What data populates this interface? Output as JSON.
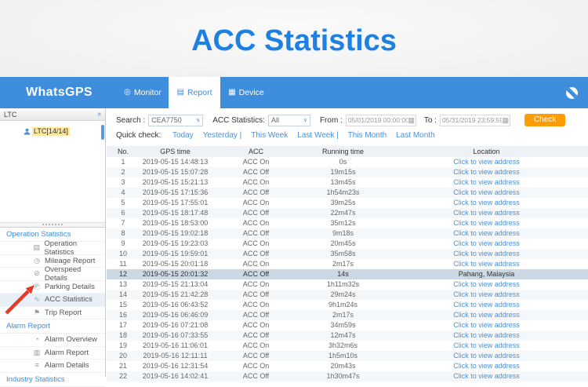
{
  "page_title": "ACC Statistics",
  "navbar": {
    "brand": "WhatsGPS",
    "tabs": [
      {
        "label": "Monitor",
        "icon": "monitor-pin-icon",
        "active": false
      },
      {
        "label": "Report",
        "icon": "report-doc-icon",
        "active": true
      },
      {
        "label": "Device",
        "icon": "device-list-icon",
        "active": false
      }
    ],
    "globe_icon": "globe-icon"
  },
  "sidebar": {
    "tree_panel_title": "LTC",
    "tree_node": "LTC[14/14]",
    "sections": [
      {
        "title": "Operation Statistics",
        "items": [
          {
            "label": "Operation Statistics",
            "icon": "operation-statistics-icon",
            "glyph": "▤",
            "selected": false
          },
          {
            "label": "Mileage Report",
            "icon": "mileage-report-icon",
            "glyph": "◷",
            "selected": false
          },
          {
            "label": "Overspeed Details",
            "icon": "overspeed-details-icon",
            "glyph": "⊘",
            "selected": false
          },
          {
            "label": "Parking Details",
            "icon": "parking-details-icon",
            "glyph": "Ⓟ",
            "selected": false
          },
          {
            "label": "ACC Statistics",
            "icon": "acc-statistics-icon",
            "glyph": "∿",
            "selected": true
          },
          {
            "label": "Trip Report",
            "icon": "trip-report-icon",
            "glyph": "⚑",
            "selected": false
          }
        ]
      },
      {
        "title": "Alarm Report",
        "items": [
          {
            "label": "Alarm Overview",
            "icon": "alarm-overview-icon",
            "glyph": "◔",
            "selected": false
          },
          {
            "label": "Alarm Report",
            "icon": "alarm-report-icon",
            "glyph": "▥",
            "selected": false
          },
          {
            "label": "Alarm Details",
            "icon": "alarm-details-icon",
            "glyph": "≡",
            "selected": false
          }
        ]
      },
      {
        "title": "Industry Statistics",
        "items": []
      }
    ]
  },
  "toolbar": {
    "search_label": "Search :",
    "search_value": "CEA7750",
    "acc_label": "ACC Statistics:",
    "acc_value": "All",
    "from_label": "From :",
    "from_value": "05/01/2019 00:00:00",
    "to_label": "To :",
    "to_value": "05/31/2019 23:59:59",
    "check_label": "Check",
    "quick_check_label": "Quick check:",
    "quick_links": [
      "Today",
      "Yesterday |",
      "This Week",
      "Last Week |",
      "This Month",
      "Last Month"
    ]
  },
  "table": {
    "columns": [
      "No.",
      "GPS time",
      "ACC",
      "Running time",
      "Location"
    ],
    "link_text": "Click to view address",
    "rows": [
      {
        "no": 1,
        "gps": "2019-05-15 14:48:13",
        "acc": "ACC On",
        "running": "0s",
        "location": "Click to view address",
        "link": true,
        "selected": false
      },
      {
        "no": 2,
        "gps": "2019-05-15 15:07:28",
        "acc": "ACC Off",
        "running": "19m15s",
        "location": "Click to view address",
        "link": true,
        "selected": false
      },
      {
        "no": 3,
        "gps": "2019-05-15 15:21:13",
        "acc": "ACC On",
        "running": "13m45s",
        "location": "Click to view address",
        "link": true,
        "selected": false
      },
      {
        "no": 4,
        "gps": "2019-05-15 17:15:36",
        "acc": "ACC Off",
        "running": "1h54m23s",
        "location": "Click to view address",
        "link": true,
        "selected": false
      },
      {
        "no": 5,
        "gps": "2019-05-15 17:55:01",
        "acc": "ACC On",
        "running": "39m25s",
        "location": "Click to view address",
        "link": true,
        "selected": false
      },
      {
        "no": 6,
        "gps": "2019-05-15 18:17:48",
        "acc": "ACC Off",
        "running": "22m47s",
        "location": "Click to view address",
        "link": true,
        "selected": false
      },
      {
        "no": 7,
        "gps": "2019-05-15 18:53:00",
        "acc": "ACC On",
        "running": "35m12s",
        "location": "Click to view address",
        "link": true,
        "selected": false
      },
      {
        "no": 8,
        "gps": "2019-05-15 19:02:18",
        "acc": "ACC Off",
        "running": "9m18s",
        "location": "Click to view address",
        "link": true,
        "selected": false
      },
      {
        "no": 9,
        "gps": "2019-05-15 19:23:03",
        "acc": "ACC On",
        "running": "20m45s",
        "location": "Click to view address",
        "link": true,
        "selected": false
      },
      {
        "no": 10,
        "gps": "2019-05-15 19:59:01",
        "acc": "ACC Off",
        "running": "35m58s",
        "location": "Click to view address",
        "link": true,
        "selected": false
      },
      {
        "no": 11,
        "gps": "2019-05-15 20:01:18",
        "acc": "ACC On",
        "running": "2m17s",
        "location": "Click to view address",
        "link": true,
        "selected": false
      },
      {
        "no": 12,
        "gps": "2019-05-15 20:01:32",
        "acc": "ACC Off",
        "running": "14s",
        "location": "Pahang, Malaysia",
        "link": false,
        "selected": true
      },
      {
        "no": 13,
        "gps": "2019-05-15 21:13:04",
        "acc": "ACC On",
        "running": "1h11m32s",
        "location": "Click to view address",
        "link": true,
        "selected": false
      },
      {
        "no": 14,
        "gps": "2019-05-15 21:42:28",
        "acc": "ACC Off",
        "running": "29m24s",
        "location": "Click to view address",
        "link": true,
        "selected": false
      },
      {
        "no": 15,
        "gps": "2019-05-16 06:43:52",
        "acc": "ACC On",
        "running": "9h1m24s",
        "location": "Click to view address",
        "link": true,
        "selected": false
      },
      {
        "no": 16,
        "gps": "2019-05-16 06:46:09",
        "acc": "ACC Off",
        "running": "2m17s",
        "location": "Click to view address",
        "link": true,
        "selected": false
      },
      {
        "no": 17,
        "gps": "2019-05-16 07:21:08",
        "acc": "ACC On",
        "running": "34m59s",
        "location": "Click to view address",
        "link": true,
        "selected": false
      },
      {
        "no": 18,
        "gps": "2019-05-16 07:33:55",
        "acc": "ACC Off",
        "running": "12m47s",
        "location": "Click to view address",
        "link": true,
        "selected": false
      },
      {
        "no": 19,
        "gps": "2019-05-16 11:06:01",
        "acc": "ACC On",
        "running": "3h32m6s",
        "location": "Click to view address",
        "link": true,
        "selected": false
      },
      {
        "no": 20,
        "gps": "2019-05-16 12:11:11",
        "acc": "ACC Off",
        "running": "1h5m10s",
        "location": "Click to view address",
        "link": true,
        "selected": false
      },
      {
        "no": 21,
        "gps": "2019-05-16 12:31:54",
        "acc": "ACC On",
        "running": "20m43s",
        "location": "Click to view address",
        "link": true,
        "selected": false
      },
      {
        "no": 22,
        "gps": "2019-05-16 14:02:41",
        "acc": "ACC Off",
        "running": "1h30m47s",
        "location": "Click to view address",
        "link": true,
        "selected": false
      }
    ]
  },
  "colors": {
    "navbar_blue": "#3e8edd",
    "title_blue": "#1d80e2",
    "link_blue": "#4a90d9",
    "check_orange": "#ff9c04",
    "selected_row": "#ccd9e5",
    "tree_highlight": "#ffe9a0",
    "arrow_red": "#e23b2e"
  }
}
